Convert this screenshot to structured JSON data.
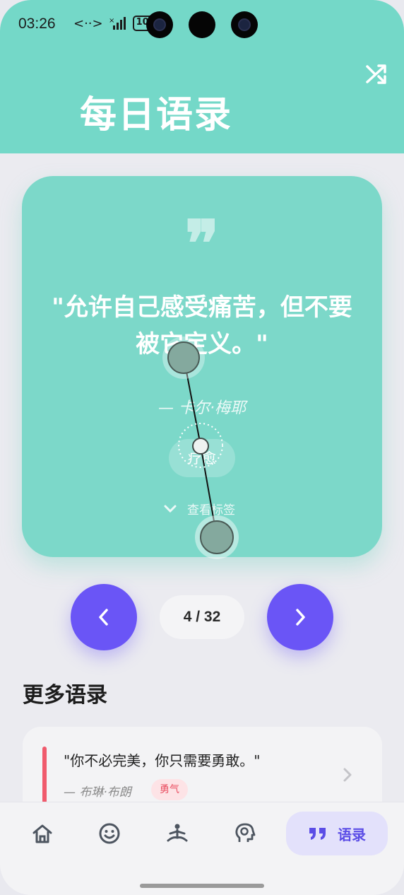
{
  "status_bar": {
    "time": "03:26",
    "signal_glyph": "<··>",
    "battery": "100"
  },
  "header": {
    "title": "每日语录",
    "shuffle_icon": "shuffle-icon",
    "background": "#74d8c8"
  },
  "quote_card": {
    "quote_icon": "quote-icon",
    "text": "\"允许自己感受痛苦，但不要被它定义。\"",
    "author": "— 卡尔·梅耶",
    "tag": "疗愈",
    "view_tags_label": "查看标签",
    "background": "#7cd8c9"
  },
  "pager": {
    "prev_icon": "chevron-left-icon",
    "next_icon": "chevron-right-icon",
    "count": "4 / 32",
    "accent": "#6a55f6"
  },
  "more_quotes": {
    "title": "更多语录",
    "items": [
      {
        "text": "\"你不必完美，你只需要勇敢。\"",
        "author": "— 布琳·布朗",
        "tag": "勇气",
        "accent": "#f05a6c"
      }
    ]
  },
  "bottom_nav": {
    "items": [
      {
        "icon": "home-icon"
      },
      {
        "icon": "smile-icon"
      },
      {
        "icon": "meditation-icon"
      },
      {
        "icon": "brain-head-icon"
      },
      {
        "icon": "quote-icon",
        "label": "语录",
        "active": true
      }
    ],
    "active_color": "#5b4de6"
  }
}
